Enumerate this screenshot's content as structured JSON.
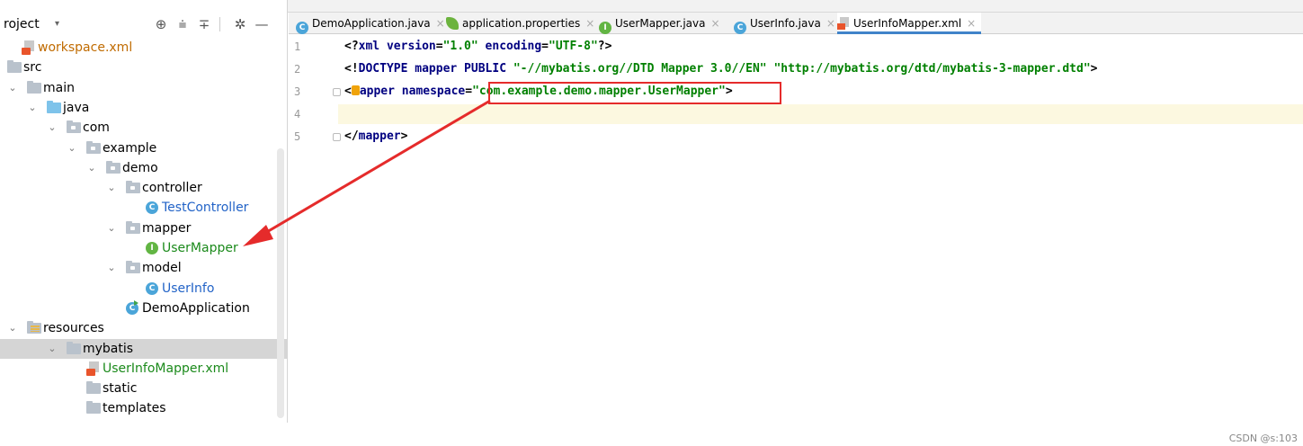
{
  "project_panel": {
    "title": "roject",
    "dropdown_glyph": "▾",
    "header_icons": [
      "crosshair-icon",
      "expand-all-icon",
      "collapse-all-icon",
      "gear-icon",
      "minimize-icon"
    ],
    "tree": [
      {
        "label": "workspace.xml",
        "icon": "xml-file-icon",
        "color": "orange",
        "expanded": null
      },
      {
        "label": "src",
        "icon": "folder-icon",
        "color": "default",
        "expanded": null
      },
      {
        "label": "main",
        "icon": "folder-icon",
        "color": "default",
        "expanded": true
      },
      {
        "label": "java",
        "icon": "source-folder-icon",
        "color": "default",
        "expanded": true
      },
      {
        "label": "com",
        "icon": "package-icon",
        "color": "default",
        "expanded": true
      },
      {
        "label": "example",
        "icon": "package-icon",
        "color": "default",
        "expanded": true
      },
      {
        "label": "demo",
        "icon": "package-icon",
        "color": "default",
        "expanded": true
      },
      {
        "label": "controller",
        "icon": "package-icon",
        "color": "default",
        "expanded": true
      },
      {
        "label": "TestController",
        "icon": "class-icon",
        "color": "blue",
        "expanded": null
      },
      {
        "label": "mapper",
        "icon": "package-icon",
        "color": "default",
        "expanded": true
      },
      {
        "label": "UserMapper",
        "icon": "interface-icon",
        "color": "green",
        "expanded": null
      },
      {
        "label": "model",
        "icon": "package-icon",
        "color": "default",
        "expanded": true
      },
      {
        "label": "UserInfo",
        "icon": "class-icon",
        "color": "blue",
        "expanded": null
      },
      {
        "label": "DemoApplication",
        "icon": "spring-class-icon",
        "color": "default",
        "expanded": null
      },
      {
        "label": "resources",
        "icon": "resources-folder-icon",
        "color": "default",
        "expanded": true
      },
      {
        "label": "mybatis",
        "icon": "folder-icon",
        "color": "default",
        "expanded": true,
        "selected": true
      },
      {
        "label": "UserInfoMapper.xml",
        "icon": "xml-file-icon",
        "color": "green",
        "expanded": null
      },
      {
        "label": "static",
        "icon": "folder-icon",
        "color": "default",
        "expanded": null
      },
      {
        "label": "templates",
        "icon": "folder-icon",
        "color": "default",
        "expanded": null
      }
    ]
  },
  "tabs": [
    {
      "label": "DemoApplication.java",
      "icon": "spring-class-icon",
      "active": false
    },
    {
      "label": "application.properties",
      "icon": "spring-leaf-icon",
      "active": false
    },
    {
      "label": "UserMapper.java",
      "icon": "interface-icon",
      "active": false
    },
    {
      "label": "UserInfo.java",
      "icon": "class-icon",
      "active": false
    },
    {
      "label": "UserInfoMapper.xml",
      "icon": "xml-file-icon",
      "active": true
    }
  ],
  "tab_close_glyph": "×",
  "editor": {
    "line_numbers": [
      "1",
      "2",
      "3",
      "4",
      "5"
    ],
    "lines": [
      {
        "parts": [
          [
            "p",
            "<?"
          ],
          [
            "k",
            "xml version"
          ],
          [
            "p",
            "="
          ],
          [
            "s",
            "\"1.0\""
          ],
          [
            "p",
            " "
          ],
          [
            "k",
            "encoding"
          ],
          [
            "p",
            "="
          ],
          [
            "s",
            "\"UTF-8\""
          ],
          [
            "p",
            "?>"
          ]
        ]
      },
      {
        "parts": [
          [
            "p",
            "<!"
          ],
          [
            "k",
            "DOCTYPE mapper PUBLIC"
          ],
          [
            "p",
            " "
          ],
          [
            "s",
            "\"-//mybatis.org//DTD Mapper 3.0//EN\""
          ],
          [
            "p",
            " "
          ],
          [
            "s",
            "\"http://mybatis.org/dtd/mybatis-3-mapper.dtd\""
          ],
          [
            "p",
            ">"
          ]
        ]
      },
      {
        "parts": [
          [
            "p",
            "<"
          ],
          [
            "bulb",
            ""
          ],
          [
            "k",
            "apper namespace"
          ],
          [
            "p",
            "="
          ],
          [
            "s",
            "\"com.example.demo.mapper.UserMapper\""
          ],
          [
            "p",
            ">"
          ]
        ]
      },
      {
        "parts": []
      },
      {
        "parts": [
          [
            "p",
            "</"
          ],
          [
            "k",
            "mapper"
          ],
          [
            "p",
            ">"
          ]
        ]
      }
    ],
    "current_line": 4
  },
  "annotation": {
    "highlight_text": "\"com.example.demo.mapper.UserMapper\"",
    "points_to": "UserMapper",
    "color": "#e52b2b"
  },
  "watermark": "CSDN @s:103"
}
